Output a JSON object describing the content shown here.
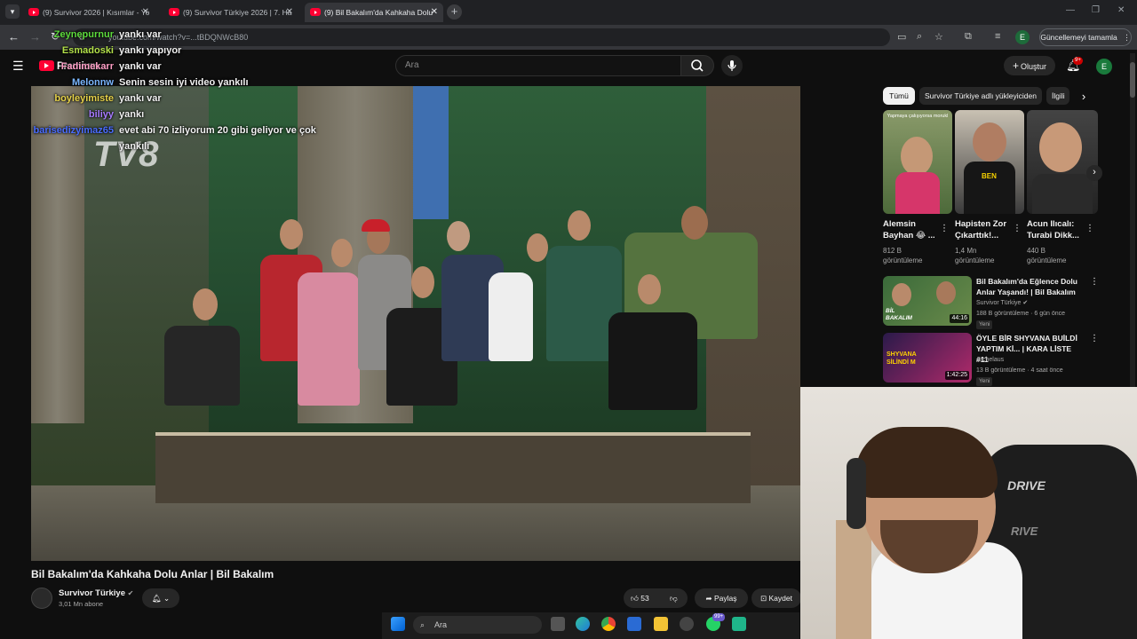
{
  "browser": {
    "tabs": [
      {
        "title": "(9) Survivor 2026 | Kısımlar - Yo"
      },
      {
        "title": "(9) Survivor Türkiye 2026 | 7. Ha"
      },
      {
        "title": "(9) Bil Bakalım'da Kahkaha Dolu"
      }
    ],
    "new_tab": "+",
    "url": "youtube.com/watch?v=...tBDQNWcB80",
    "update_button": "Güncellemeyi tamamla",
    "profile_initial": "E"
  },
  "youtube": {
    "logo_text": "Premium",
    "search_placeholder": "Ara",
    "create_label": "Oluştur",
    "notifications_badge": "9+",
    "avatar_initial": "E"
  },
  "video": {
    "watermark": "TV8",
    "title": "Bil Bakalım'da Kahkaha Dolu Anlar | Bil Bakalım",
    "channel": "Survivor Türkiye",
    "subscribers": "3,01 Mn abone",
    "likes": "53",
    "share_label": "Paylaş",
    "save_label": "Kaydet"
  },
  "chat": [
    {
      "user": "Zeynepurnur",
      "msg": "yankı var",
      "color": "#5ddb3c"
    },
    {
      "user": "Esmadoski",
      "msg": "yankı yapıyor",
      "color": "#b3e04a"
    },
    {
      "user": "Fadimekarr",
      "msg": "yankı var",
      "color": "#ff9ec6"
    },
    {
      "user": "Melonnw",
      "msg": "Senin sesin iyi video yankılı",
      "color": "#7ab6ff"
    },
    {
      "user": "boyleyimiste",
      "msg": "yankı var",
      "color": "#e6d24a"
    },
    {
      "user": "biliyy",
      "msg": "yankı",
      "color": "#a77bff"
    },
    {
      "user": "barisedizyimaz65",
      "msg": "evet abi 70 izliyorum 20 gibi geliyor ve çok",
      "color": "#4a6dff"
    },
    {
      "user": "",
      "msg": "yankılı",
      "color": "#ffffff"
    }
  ],
  "sidebar": {
    "chips": [
      "Tümü",
      "Survivor Türkiye adlı yükleyiciden",
      "İlgili"
    ],
    "shorts": [
      {
        "title": "Alemsin Bayhan 😂 ...",
        "views": "812 B görüntüleme",
        "thumb_caption": "Yapmaya çalışıyorsa morukl"
      },
      {
        "title": "Hapisten Zor Çıkarttık!...",
        "views": "1,4 Mn görüntüleme",
        "thumb_caption": "BEN"
      },
      {
        "title": "Acun Ilıcalı: Turabi Dikk...",
        "views": "440 B görüntüleme",
        "thumb_caption": ""
      }
    ],
    "recommendations": [
      {
        "title": "Bil Bakalım'da Eğlence Dolu Anlar Yaşandı! | Bil Bakalım",
        "channel": "Survivor Türkiye",
        "meta": "188 B görüntüleme · 6 gün önce",
        "badge": "Yeni",
        "duration": "44:16",
        "thumb_text": "BİL BAKALIM"
      },
      {
        "title": "ÖYLE BİR SHYVANA BUİLDİ YAPTIM Kİ... | KARA LİSTE #11",
        "channel": "Archelaus",
        "meta": "13 B görüntüleme · 4 saat önce",
        "badge": "Yeni",
        "duration": "1:42:25",
        "thumb_text": "SHYVANA SİLİNDİ M"
      }
    ]
  },
  "webcam": {
    "chair_brand": "DRIVE",
    "chair_brand_2": "RIVE"
  },
  "taskbar": {
    "search_placeholder": "Ara",
    "notif_badge": "99+"
  }
}
